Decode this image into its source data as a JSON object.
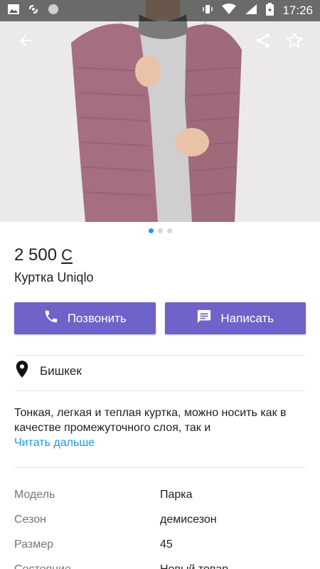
{
  "status_bar": {
    "time": "17:26",
    "icons": [
      "image-icon",
      "cloud-sync-icon",
      "circle-icon",
      "vibrate-icon",
      "wifi-icon",
      "signal-icon",
      "battery-icon"
    ]
  },
  "appbar": {
    "icons": [
      "back-arrow-icon",
      "share-icon",
      "star-icon"
    ]
  },
  "gallery": {
    "total": 3,
    "active_index": 0
  },
  "listing": {
    "price": "2 500",
    "currency_symbol": "С",
    "title": "Куртка Uniqlo"
  },
  "actions": {
    "call_label": "Позвонить",
    "message_label": "Написать"
  },
  "location": {
    "city": "Бишкек"
  },
  "description": {
    "text": "Тонкая, легкая и теплая куртка, можно носить как в качестве промежуточного слоя, так и",
    "read_more": "Читать дальше"
  },
  "specs": [
    {
      "label": "Модель",
      "value": "Парка"
    },
    {
      "label": "Сезон",
      "value": "демисезон"
    },
    {
      "label": "Размер",
      "value": "45"
    },
    {
      "label": "Состояние",
      "value": "Новый товар"
    }
  ],
  "colors": {
    "accent": "#6f63c9",
    "link": "#1e9bd7",
    "dot_active": "#2196f3",
    "jacket": "#a56f7f"
  }
}
